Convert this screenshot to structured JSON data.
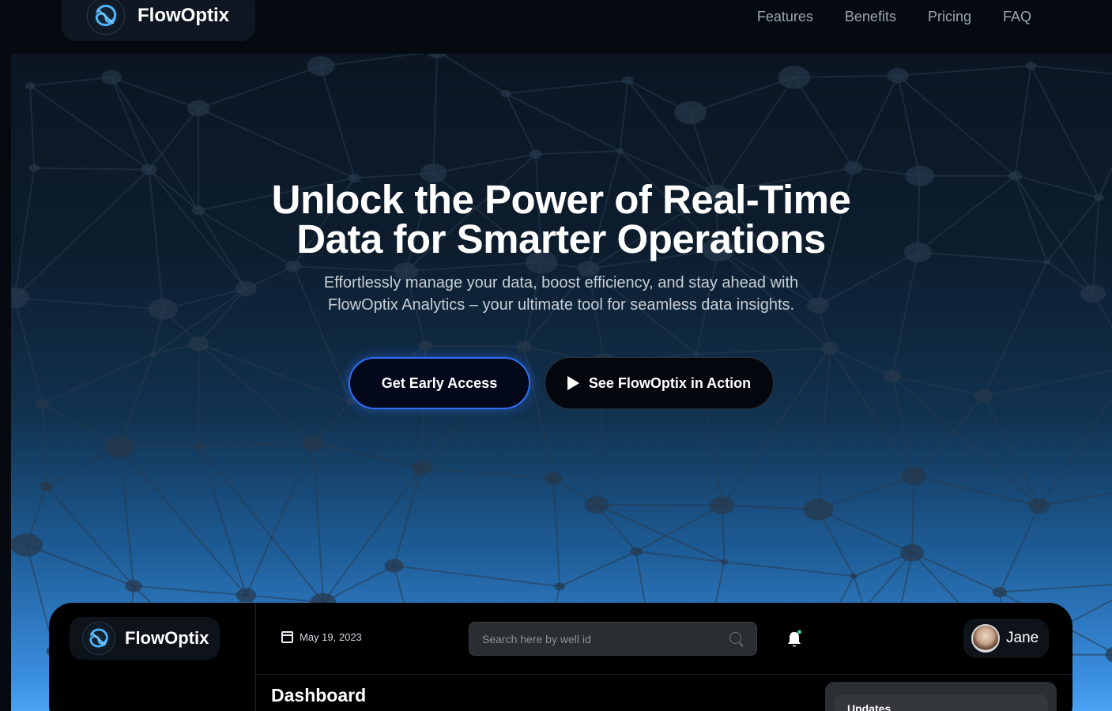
{
  "nav": {
    "brand": "FlowOptix",
    "links": [
      "Features",
      "Benefits",
      "Pricing",
      "FAQ"
    ]
  },
  "hero": {
    "title_line1": "Unlock the Power of Real-Time",
    "title_line2": "Data for Smarter Operations",
    "subtitle": "Effortlessly manage your data, boost efficiency, and stay ahead with FlowOptix Analytics – your ultimate tool for seamless data insights.",
    "primary_cta": "Get Early Access",
    "secondary_cta": "See FlowOptix in Action"
  },
  "dashboard": {
    "brand": "FlowOptix",
    "date": "May 19, 2023",
    "search_placeholder": "Search here by well id",
    "user_name": "Jane",
    "page_title": "Dashboard",
    "updates_title": "Updates"
  },
  "colors": {
    "accent": "#2f6ff5",
    "background": "#050a10",
    "notification_dot": "#3fd6a0"
  }
}
